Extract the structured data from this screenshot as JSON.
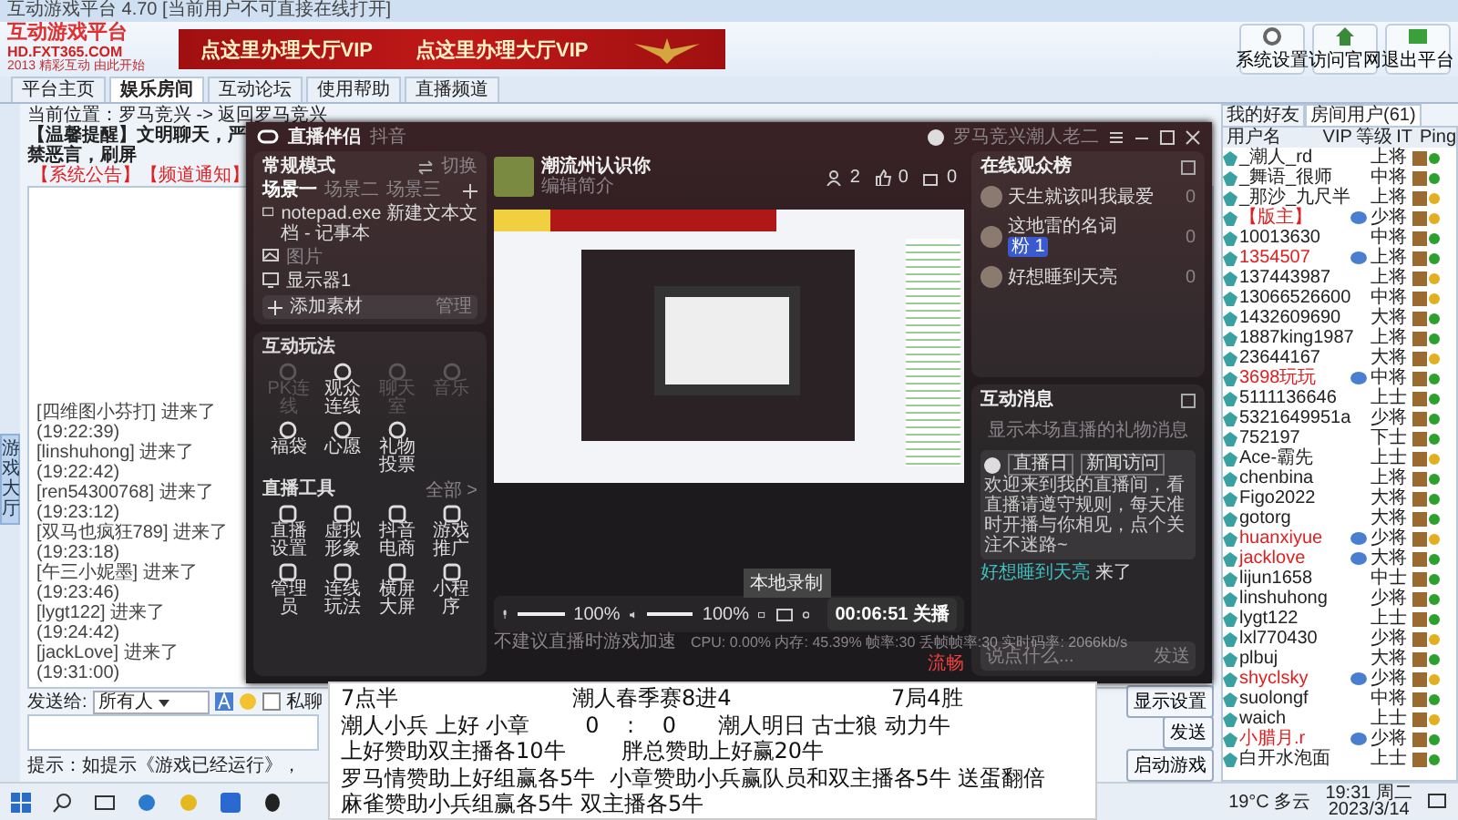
{
  "window": {
    "title": "互动游戏平台 4.70 [当前用户不可直接在线打开]"
  },
  "header": {
    "logo_title": "互动游戏平台",
    "logo_url": "HD.FXT365.COM",
    "logo_slogan": "2013 精彩互动 由此开始",
    "banner": [
      "点这里办理大厅VIP",
      "点这里办理大厅VIP"
    ],
    "buttons": [
      "系统设置",
      "访问官网",
      "退出平台"
    ]
  },
  "tabs": [
    {
      "label": "平台主页",
      "selected": false
    },
    {
      "label": "娱乐房间",
      "selected": true
    },
    {
      "label": "互动论坛",
      "selected": false
    },
    {
      "label": "使用帮助",
      "selected": false
    },
    {
      "label": "直播频道",
      "selected": false
    }
  ],
  "side_tab": "游戏大厅",
  "room": {
    "location": "当前位置：罗马竞兴 -> 返回罗马竞兴",
    "reminder": "【温馨提醒】文明聊天，严禁恶言，刷屏",
    "notice": "【系统公告】【频道通知】",
    "log": [
      {
        "name": "[四维图小芬打]",
        "text": "进来了(19:22:39)"
      },
      {
        "name": "[linshuhong]",
        "text": "进来了(19:22:42)"
      },
      {
        "name": "[ren54300768]",
        "text": "进来了(19:23:12)"
      },
      {
        "name": "[双马也疯狂789]",
        "text": "进来了(19:23:18)"
      },
      {
        "name": "[午三小妮墨]",
        "text": "进来了(19:23:46)"
      },
      {
        "name": "[lygt122]",
        "text": "进来了(19:24:42)"
      },
      {
        "name": "[jackLove]",
        "text": "进来了(19:31:00)"
      }
    ],
    "send_to_label": "发送给:",
    "recipient": "所有人",
    "private_label": "私聊",
    "private": false,
    "send_button": "发送",
    "hint": "提示：如提示《游戏已经运行》，",
    "buttons": [
      "显示设置",
      "启动游戏"
    ]
  },
  "users_panel": {
    "tabs": [
      {
        "label": "我的好友",
        "selected": false
      },
      {
        "label": "房间用户(61)",
        "selected": true
      }
    ],
    "columns": [
      "用户名",
      "VIP",
      "等级",
      "IT",
      "Ping"
    ],
    "rows": [
      {
        "name": "_潮人_rd",
        "vip": false,
        "rank": "上将",
        "color": "#2ea02e"
      },
      {
        "name": "_舞语_很师",
        "vip": false,
        "rank": "中将",
        "color": "#2ea02e"
      },
      {
        "name": "_那沙_九尺半",
        "vip": false,
        "rank": "上将",
        "color": "#e0b020"
      },
      {
        "name": "【版主】",
        "vip": true,
        "rank": "少将",
        "color": "#e0b020"
      },
      {
        "name": "10013630",
        "vip": false,
        "rank": "中将",
        "color": "#2ea02e"
      },
      {
        "name": "1354507",
        "vip": true,
        "rank": "上将",
        "color": "#2ea02e"
      },
      {
        "name": "137443987",
        "vip": false,
        "rank": "上将",
        "color": "#e0b020"
      },
      {
        "name": "13066526600",
        "vip": false,
        "rank": "中将",
        "color": "#e0b020"
      },
      {
        "name": "1432609690",
        "vip": false,
        "rank": "大将",
        "color": "#2ea02e"
      },
      {
        "name": "1887king1987",
        "vip": false,
        "rank": "上将",
        "color": "#2ea02e"
      },
      {
        "name": "23644167",
        "vip": false,
        "rank": "大将",
        "color": "#e0b020"
      },
      {
        "name": "3698玩玩",
        "vip": true,
        "rank": "中将",
        "color": "#2ea02e"
      },
      {
        "name": "5111136646",
        "vip": false,
        "rank": "上士",
        "color": "#2ea02e"
      },
      {
        "name": "5321649951a",
        "vip": false,
        "rank": "少将",
        "color": "#2ea02e"
      },
      {
        "name": "752197",
        "vip": false,
        "rank": "下士",
        "color": "#2ea02e"
      },
      {
        "name": "Ace-霸先",
        "vip": false,
        "rank": "上士",
        "color": "#e0b020"
      },
      {
        "name": "chenbina",
        "vip": false,
        "rank": "上将",
        "color": "#2ea02e"
      },
      {
        "name": "Figo2022",
        "vip": false,
        "rank": "大将",
        "color": "#2ea02e"
      },
      {
        "name": "gotorg",
        "vip": false,
        "rank": "大将",
        "color": "#2ea02e"
      },
      {
        "name": "huanxiyue",
        "vip": true,
        "rank": "少将",
        "color": "#e0b020"
      },
      {
        "name": "jacklove",
        "vip": true,
        "rank": "大将",
        "color": "#2ea02e"
      },
      {
        "name": "lijun1658",
        "vip": false,
        "rank": "中士",
        "color": "#2ea02e"
      },
      {
        "name": "linshuhong",
        "vip": false,
        "rank": "少将",
        "color": "#2ea02e"
      },
      {
        "name": "lygt122",
        "vip": false,
        "rank": "上士",
        "color": "#2ea02e"
      },
      {
        "name": "lxl770430",
        "vip": false,
        "rank": "少将",
        "color": "#e0b020"
      },
      {
        "name": "plbuj",
        "vip": false,
        "rank": "大将",
        "color": "#2ea02e"
      },
      {
        "name": "shyclsky",
        "vip": true,
        "rank": "少将",
        "color": "#e0b020"
      },
      {
        "name": "suolongf",
        "vip": false,
        "rank": "中将",
        "color": "#2ea02e"
      },
      {
        "name": "waich",
        "vip": false,
        "rank": "上士",
        "color": "#e0b020"
      },
      {
        "name": "小腊月.r",
        "vip": true,
        "rank": "少将",
        "color": "#2ea02e"
      },
      {
        "name": "白开水泡面",
        "vip": false,
        "rank": "上士",
        "color": "#2ea02e"
      }
    ]
  },
  "live": {
    "title": "直播伴侣",
    "platform": "抖音",
    "user": "罗马竞兴潮人老二",
    "mode": "常规模式",
    "switch": "切换",
    "scenes": [
      {
        "label": "场景一",
        "selected": true
      },
      {
        "label": "场景二",
        "selected": false
      },
      {
        "label": "场景三",
        "selected": false
      }
    ],
    "sources": [
      {
        "kind": "window",
        "label": "notepad.exe 新建文本文档 - 记事本"
      },
      {
        "kind": "image",
        "label": "图片"
      },
      {
        "kind": "display",
        "label": "显示器1"
      }
    ],
    "add_source": "添加素材",
    "manage": "管理",
    "play_title": "互动玩法",
    "play": [
      {
        "label": "PK连线",
        "disabled": true
      },
      {
        "label": "观众连线",
        "disabled": false
      },
      {
        "label": "聊天室",
        "disabled": true
      },
      {
        "label": "音乐",
        "disabled": true
      },
      {
        "label": "福袋",
        "disabled": false
      },
      {
        "label": "心愿",
        "disabled": false
      },
      {
        "label": "礼物投票",
        "disabled": false
      }
    ],
    "tools_title": "直播工具",
    "tools_all": "全部 >",
    "tools": [
      "直播设置",
      "虚拟形象",
      "抖音电商",
      "游戏推广",
      "管理员",
      "连线玩法",
      "横屏大屏",
      "小程序"
    ],
    "room_name": "潮流州认识你",
    "room_desc": "编辑简介",
    "stats": [
      "2",
      "0",
      "0"
    ],
    "mic": {
      "level": 1,
      "reading": "100%"
    },
    "speaker": {
      "level": 1,
      "reading": "100%"
    },
    "tooltip": "本地录制",
    "timer": "00:06:51",
    "stop": "关播",
    "tip": "不建议直播时游戏加速",
    "perf": "CPU: 0.00%  内存: 45.39%  帧率:30  丢帧帧率:30  实时码率: 2066kb/s",
    "quality": "流畅",
    "audience_title": "在线观众榜",
    "audience": [
      {
        "name": "天生就该叫我最爱",
        "score": "0"
      },
      {
        "name": "这地雷的名词",
        "score": "0",
        "badge": "粉 1"
      },
      {
        "name": "好想睡到天亮",
        "score": "0"
      }
    ],
    "messages_title": "互动消息",
    "messages_empty": "显示本场直播的礼物消息",
    "system_tags": [
      "直播日",
      "新闻访问"
    ],
    "system_text": "欢迎来到我的直播间，看直播请遵守规则，每天准时开播与你相见，点个关注不迷路~",
    "arrival_name": "好想睡到天亮",
    "arrival_text": "来了",
    "input_placeholder": "说点什么...",
    "send": "发送"
  },
  "notepad": {
    "lines": [
      "7点半                         潮人春季赛8进4                       7局4胜",
      "潮人小兵 上好 小章        0    :    0      潮人明日 古士狼 动力牛",
      "上好赞助双主播各10牛        胖总赞助上好赢20牛",
      "罗马情赞助上好组赢各5牛  小章赞助小兵赢队员和双主播各5牛 送蛋翻倍",
      "麻雀赞助小兵组赢各5牛 双主播各5牛"
    ]
  },
  "taskbar": {
    "weather": "19°C 多云",
    "time": "19:31 周二",
    "date": "2023/3/14"
  }
}
